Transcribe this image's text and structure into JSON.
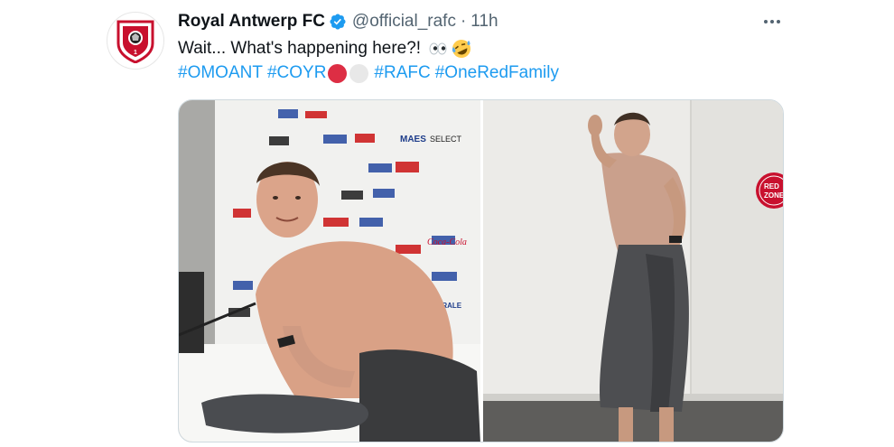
{
  "tweet": {
    "display_name": "Royal Antwerp FC",
    "handle": "@official_rafc",
    "separator": "·",
    "time": "11h",
    "text": "Wait... What's happening here?!",
    "emojis": [
      "eyes-icon",
      "rolling-laughing-icon"
    ],
    "hashtags": [
      "#OMOANT",
      "#COYR",
      "#RAFC",
      "#OneRedFamily"
    ],
    "colored_circles": [
      "#dd2e44",
      "#e8e8e8"
    ],
    "more_icon": "more-horizontal-icon",
    "avatar_badge_number": "1",
    "media": [
      {
        "description": "photo-press-conference",
        "sponsor_labels": [
          "MAES",
          "SELECT",
          "Coca-Cola",
          "FEDERALE"
        ]
      },
      {
        "description": "photo-dressing-room",
        "sign_text": [
          "RED",
          "ZONE"
        ]
      }
    ]
  },
  "colors": {
    "link": "#1d9bf0",
    "muted": "#536471",
    "verified": "#1d9bf0"
  }
}
